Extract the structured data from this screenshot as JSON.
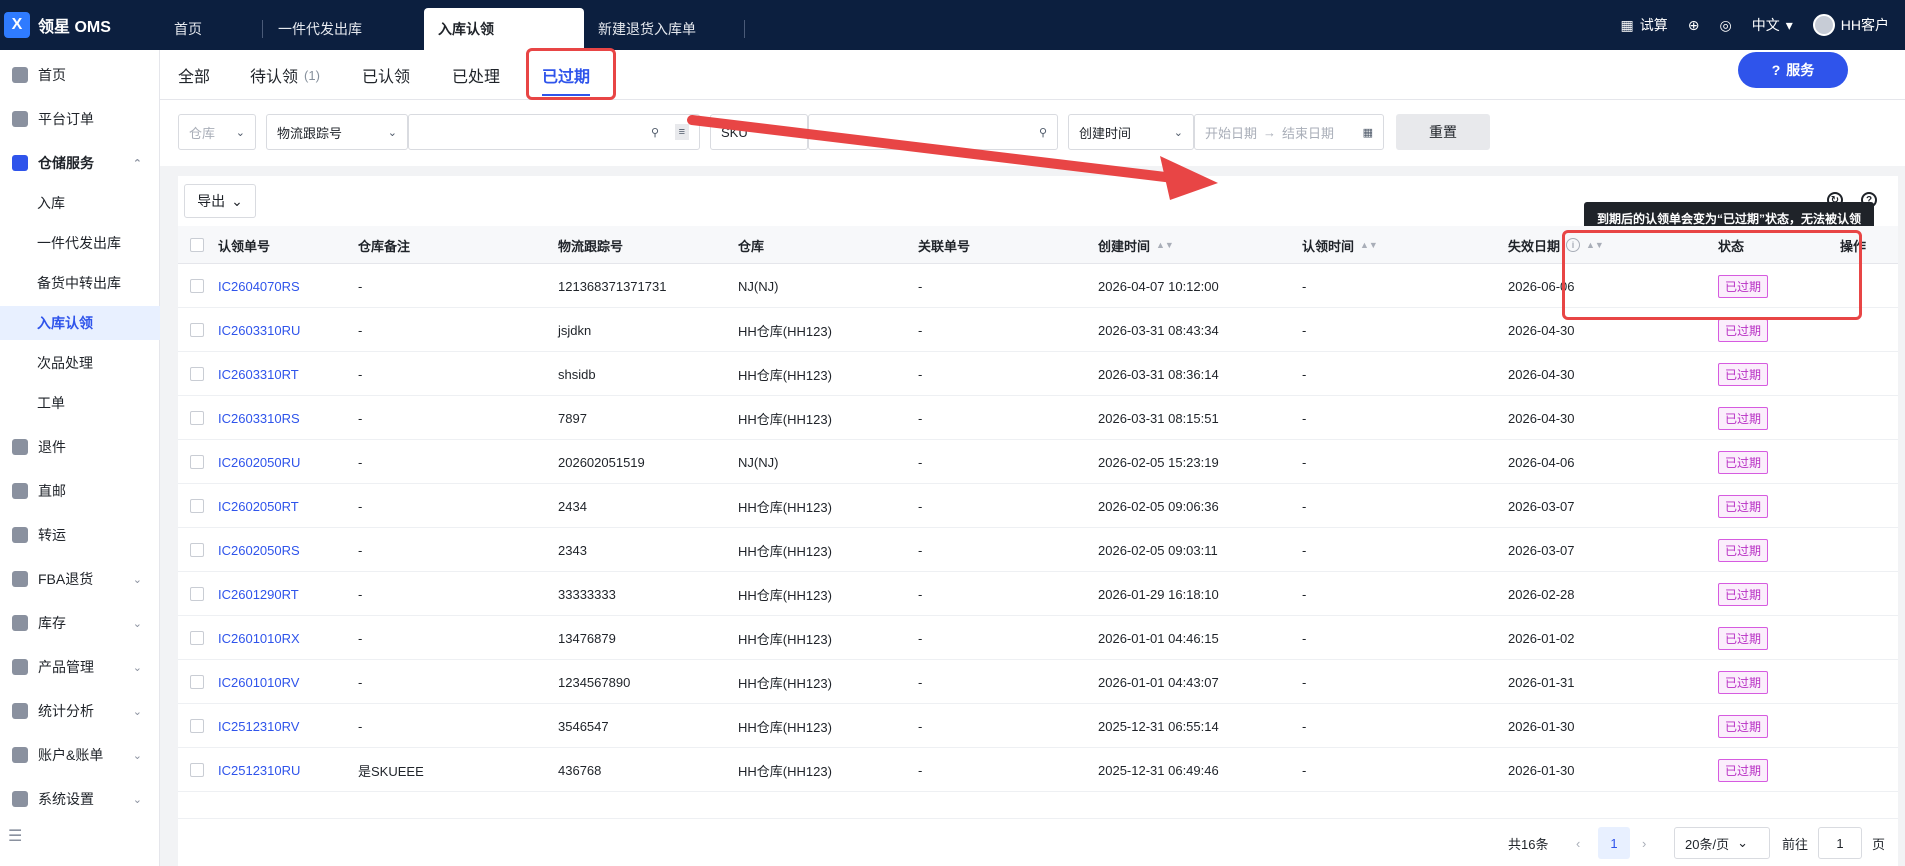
{
  "app": {
    "logo_text": "领星 OMS",
    "logo_mark": "X"
  },
  "top_tabs": [
    "首页",
    "一件代发出库",
    "入库认领",
    "新建退货入库单"
  ],
  "top_right": {
    "trial": "试算",
    "language": "中文",
    "user": "HH客户"
  },
  "sidebar": {
    "items": [
      {
        "label": "首页",
        "icon": "home-icon"
      },
      {
        "label": "平台订单",
        "icon": "order-icon"
      },
      {
        "label": "仓储服务",
        "icon": "warehouse-icon"
      },
      {
        "label": "退件",
        "icon": "return-icon"
      },
      {
        "label": "直邮",
        "icon": "direct-mail-icon"
      },
      {
        "label": "转运",
        "icon": "transfer-icon"
      },
      {
        "label": "FBA退货",
        "icon": "fba-icon"
      },
      {
        "label": "库存",
        "icon": "inventory-icon"
      },
      {
        "label": "产品管理",
        "icon": "product-icon"
      },
      {
        "label": "统计分析",
        "icon": "stats-icon"
      },
      {
        "label": "账户&账单",
        "icon": "account-icon"
      },
      {
        "label": "系统设置",
        "icon": "settings-icon"
      }
    ],
    "sub_items": [
      "入库",
      "一件代发出库",
      "备货中转出库",
      "入库认领",
      "次品处理",
      "工单"
    ]
  },
  "status_tabs": [
    {
      "label": "全部",
      "count": ""
    },
    {
      "label": "待认领",
      "count": "(1)"
    },
    {
      "label": "已认领",
      "count": ""
    },
    {
      "label": "已处理",
      "count": ""
    },
    {
      "label": "已过期",
      "count": ""
    }
  ],
  "service_button": "服务",
  "filters": {
    "warehouse": "仓库",
    "tracking_type": "物流跟踪号",
    "sku": "SKU",
    "time_type": "创建时间",
    "start_date": "开始日期",
    "end_date": "结束日期",
    "reset": "重置"
  },
  "export_button": "导出",
  "tooltip": "到期后的认领单会变为“已过期”状态，无法被认领",
  "columns": [
    "认领单号",
    "仓库备注",
    "物流跟踪号",
    "仓库",
    "关联单号",
    "创建时间",
    "认领时间",
    "失效日期",
    "状态",
    "操作"
  ],
  "rows": [
    {
      "id": "IC2604070RS",
      "note": "-",
      "tracking": "121368371371731",
      "warehouse": "NJ(NJ)",
      "related": "-",
      "created": "2026-04-07 10:12:00",
      "claimed": "-",
      "expire": "2026-06-06",
      "status": "已过期"
    },
    {
      "id": "IC2603310RU",
      "note": "-",
      "tracking": "jsjdkn",
      "warehouse": "HH仓库(HH123)",
      "related": "-",
      "created": "2026-03-31 08:43:34",
      "claimed": "-",
      "expire": "2026-04-30",
      "status": "已过期"
    },
    {
      "id": "IC2603310RT",
      "note": "-",
      "tracking": "shsidb",
      "warehouse": "HH仓库(HH123)",
      "related": "-",
      "created": "2026-03-31 08:36:14",
      "claimed": "-",
      "expire": "2026-04-30",
      "status": "已过期"
    },
    {
      "id": "IC2603310RS",
      "note": "-",
      "tracking": "7897",
      "warehouse": "HH仓库(HH123)",
      "related": "-",
      "created": "2026-03-31 08:15:51",
      "claimed": "-",
      "expire": "2026-04-30",
      "status": "已过期"
    },
    {
      "id": "IC2602050RU",
      "note": "-",
      "tracking": "202602051519",
      "warehouse": "NJ(NJ)",
      "related": "-",
      "created": "2026-02-05 15:23:19",
      "claimed": "-",
      "expire": "2026-04-06",
      "status": "已过期"
    },
    {
      "id": "IC2602050RT",
      "note": "-",
      "tracking": "2434",
      "warehouse": "HH仓库(HH123)",
      "related": "-",
      "created": "2026-02-05 09:06:36",
      "claimed": "-",
      "expire": "2026-03-07",
      "status": "已过期"
    },
    {
      "id": "IC2602050RS",
      "note": "-",
      "tracking": "2343",
      "warehouse": "HH仓库(HH123)",
      "related": "-",
      "created": "2026-02-05 09:03:11",
      "claimed": "-",
      "expire": "2026-03-07",
      "status": "已过期"
    },
    {
      "id": "IC2601290RT",
      "note": "-",
      "tracking": "33333333",
      "warehouse": "HH仓库(HH123)",
      "related": "-",
      "created": "2026-01-29 16:18:10",
      "claimed": "-",
      "expire": "2026-02-28",
      "status": "已过期"
    },
    {
      "id": "IC2601010RX",
      "note": "-",
      "tracking": "13476879",
      "warehouse": "HH仓库(HH123)",
      "related": "-",
      "created": "2026-01-01 04:46:15",
      "claimed": "-",
      "expire": "2026-01-02",
      "status": "已过期"
    },
    {
      "id": "IC2601010RV",
      "note": "-",
      "tracking": "1234567890",
      "warehouse": "HH仓库(HH123)",
      "related": "-",
      "created": "2026-01-01 04:43:07",
      "claimed": "-",
      "expire": "2026-01-31",
      "status": "已过期"
    },
    {
      "id": "IC2512310RV",
      "note": "-",
      "tracking": "3546547",
      "warehouse": "HH仓库(HH123)",
      "related": "-",
      "created": "2025-12-31 06:55:14",
      "claimed": "-",
      "expire": "2026-01-30",
      "status": "已过期"
    },
    {
      "id": "IC2512310RU",
      "note": "是SKUEEE",
      "tracking": "436768",
      "warehouse": "HH仓库(HH123)",
      "related": "-",
      "created": "2025-12-31 06:49:46",
      "claimed": "-",
      "expire": "2026-01-30",
      "status": "已过期"
    }
  ],
  "pagination": {
    "total": "共16条",
    "current": "1",
    "page_size": "20条/页",
    "goto_label": "前往",
    "goto_value": "1",
    "page_suffix": "页"
  },
  "colors": {
    "topbar": "#0c1f3f",
    "accent": "#2f54eb",
    "highlight": "#e84545",
    "badge": "#b82fc4"
  }
}
